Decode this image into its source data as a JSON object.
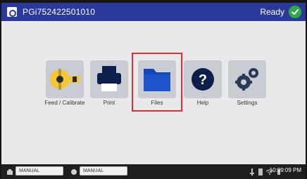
{
  "header": {
    "device_name": "PGi752422501010",
    "status": "Ready"
  },
  "tiles": [
    {
      "id": "feed-calibrate",
      "label": "Feed / Calibrate",
      "icon": "feed-calibrate-icon"
    },
    {
      "id": "print",
      "label": "Print",
      "icon": "printer-icon"
    },
    {
      "id": "files",
      "label": "Files",
      "icon": "folder-icon"
    },
    {
      "id": "help",
      "label": "Help",
      "icon": "help-icon"
    },
    {
      "id": "settings",
      "label": "Settings",
      "icon": "settings-icon"
    }
  ],
  "footer": {
    "left_mode": "MANUAL",
    "right_mode": "MANUAL",
    "time": "10:09:09 PM"
  },
  "colors": {
    "header": "#2b3a9a",
    "tile": "#c9ccd3",
    "ready": "#2fa84a",
    "highlight": "#e03030"
  }
}
